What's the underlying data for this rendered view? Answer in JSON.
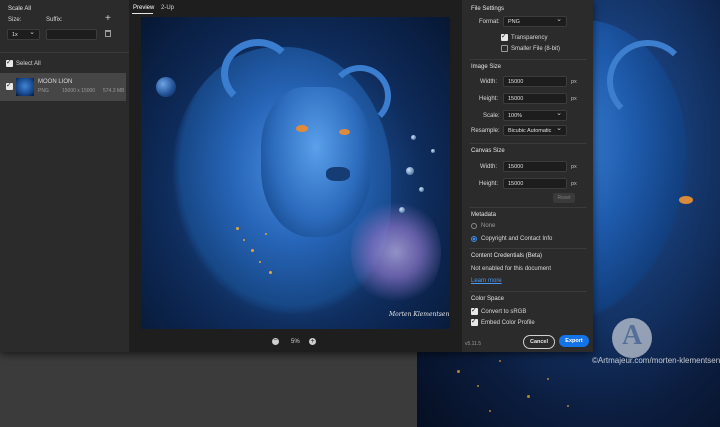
{
  "left_panel": {
    "title": "Scale All",
    "size_label": "Size:",
    "suffix_label": "Suffix:",
    "size_value": "1x",
    "suffix_value": "",
    "select_all_label": "Select All",
    "asset": {
      "name": "MOON LION",
      "format": "PNG",
      "dimensions": "15000 x 15000",
      "filesize": "574.3 MB"
    }
  },
  "preview_tabs": [
    "Preview",
    "2-Up"
  ],
  "zoom": {
    "value": "5%"
  },
  "signature": "Morten Klementsen",
  "file_settings": {
    "heading": "File Settings",
    "format_label": "Format:",
    "format_value": "PNG",
    "transparency_label": "Transparency",
    "smaller_file_label": "Smaller File (8-bit)"
  },
  "image_size": {
    "heading": "Image Size",
    "width_label": "Width:",
    "width_value": "15000",
    "height_label": "Height:",
    "height_value": "15000",
    "unit": "px",
    "scale_label": "Scale:",
    "scale_value": "100%",
    "resample_label": "Resample:",
    "resample_value": "Bicubic Automatic"
  },
  "canvas_size": {
    "heading": "Canvas Size",
    "width_label": "Width:",
    "width_value": "15000",
    "height_label": "Height:",
    "height_value": "15000",
    "unit": "px",
    "reset_label": "Reset"
  },
  "metadata": {
    "heading": "Metadata",
    "option_none": "None",
    "option_copyright": "Copyright and Contact Info"
  },
  "content_credentials": {
    "heading": "Content Credentials (Beta)",
    "status": "Not enabled for this document",
    "learn_more": "Learn more"
  },
  "color_space": {
    "heading": "Color Space",
    "convert_label": "Convert to sRGB",
    "embed_label": "Embed Color Profile"
  },
  "footer": {
    "version": "v5.11.5",
    "cancel_label": "Cancel",
    "export_label": "Export"
  },
  "watermark": {
    "text": "©Artmajeur.com/morten-klementsen"
  },
  "colors": {
    "accent": "#3a8be6",
    "dialog_bg": "#2b2b2b",
    "preview_bg": "#1e1e1e"
  }
}
